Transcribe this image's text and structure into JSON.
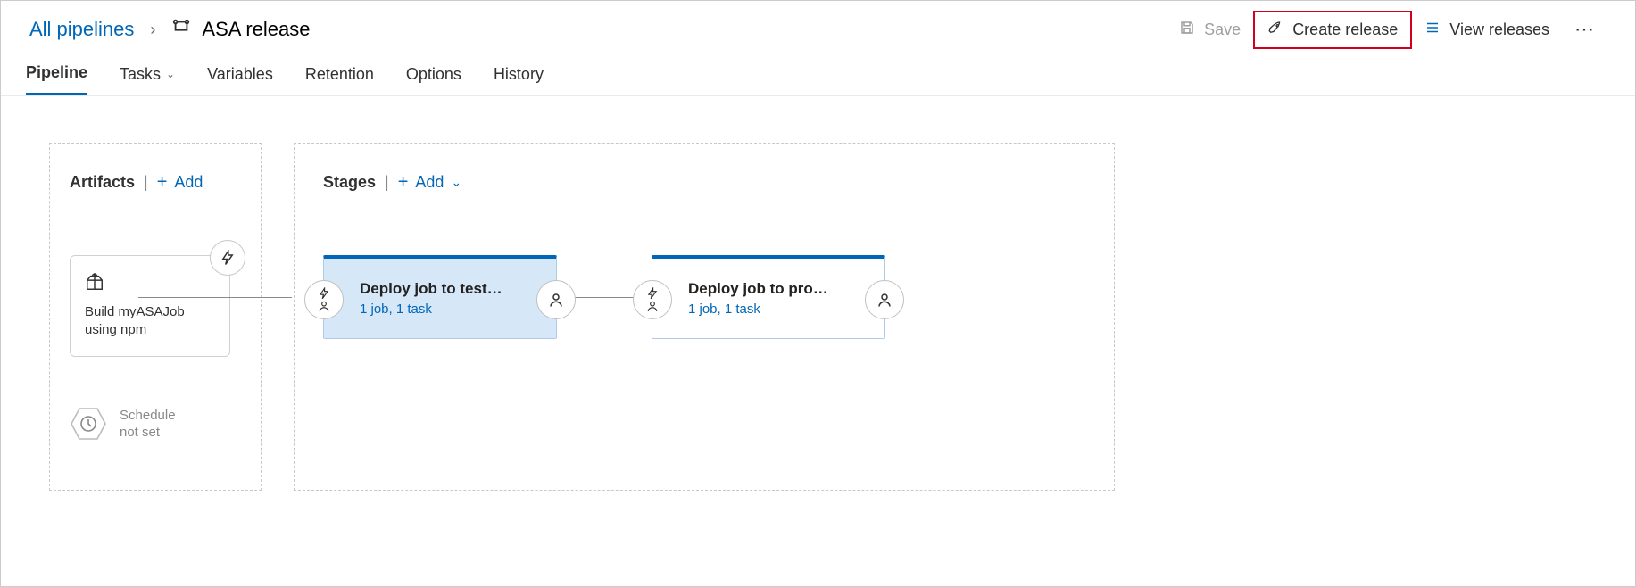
{
  "breadcrumb": {
    "root": "All pipelines",
    "title": "ASA release"
  },
  "header": {
    "save": "Save",
    "create_release": "Create release",
    "view_releases": "View releases"
  },
  "tabs": {
    "pipeline": "Pipeline",
    "tasks": "Tasks",
    "variables": "Variables",
    "retention": "Retention",
    "options": "Options",
    "history": "History"
  },
  "artifacts": {
    "title": "Artifacts",
    "add": "Add",
    "card_text": "Build myASAJob using npm",
    "schedule_line1": "Schedule",
    "schedule_line2": "not set"
  },
  "stages": {
    "title": "Stages",
    "add": "Add",
    "items": [
      {
        "title": "Deploy job to test…",
        "meta": "1 job, 1 task",
        "selected": true
      },
      {
        "title": "Deploy job to pro…",
        "meta": "1 job, 1 task",
        "selected": false
      }
    ]
  }
}
